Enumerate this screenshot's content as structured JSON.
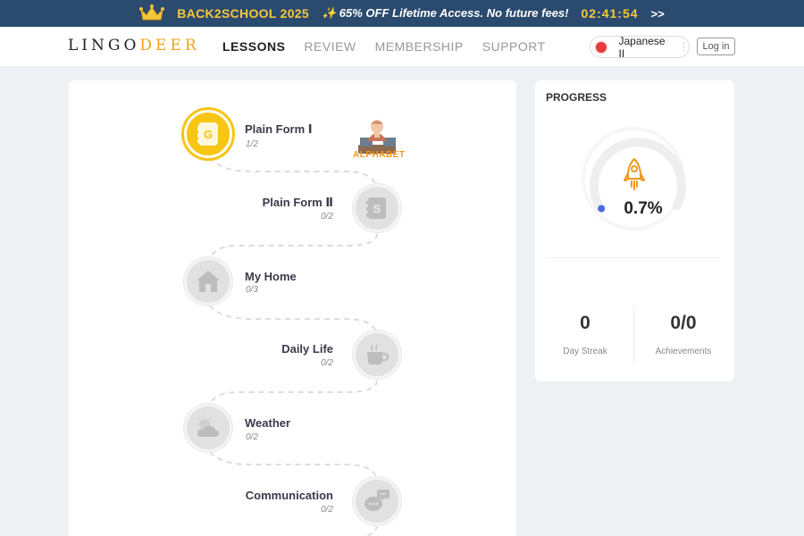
{
  "promo": {
    "code": "BACK2SCHOOL 2025",
    "offer": "✨ 65% OFF Lifetime Access. No future fees!",
    "timer": "02:41:54",
    "more": ">>"
  },
  "header": {
    "logo_left": "LINGO",
    "logo_right": "DEER",
    "nav": [
      "LESSONS",
      "REVIEW",
      "MEMBERSHIP",
      "SUPPORT"
    ],
    "active_nav": "LESSONS",
    "language": "Japanese II",
    "login": "Log in"
  },
  "alphabet": {
    "label": "ALPHABET",
    "icon": "alphabet-character-icon"
  },
  "lessons": [
    {
      "title": "Plain Form Ⅰ",
      "progress": "1/2",
      "icon": "letter-g-icon",
      "glyph": "G",
      "active": true
    },
    {
      "title": "Plain Form Ⅱ",
      "progress": "0/2",
      "icon": "letter-s-icon",
      "glyph": "S",
      "active": false
    },
    {
      "title": "My Home",
      "progress": "0/3",
      "icon": "house-icon",
      "active": false
    },
    {
      "title": "Daily Life",
      "progress": "0/2",
      "icon": "coffee-cup-icon",
      "active": false
    },
    {
      "title": "Weather",
      "progress": "0/2",
      "icon": "sun-cloud-icon",
      "active": false
    },
    {
      "title": "Communication",
      "progress": "0/2",
      "icon": "chat-bubbles-icon",
      "active": false
    }
  ],
  "progress": {
    "heading": "PROGRESS",
    "percent": "0.7%",
    "fraction": 0.007,
    "icon": "rocket-icon",
    "stats": [
      {
        "value": "0",
        "label": "Day Streak"
      },
      {
        "value": "0/0",
        "label": "Achievements"
      }
    ]
  },
  "colors": {
    "banner": "#2a4a6e",
    "banner_accent": "#f6c83b",
    "brand_accent": "#f4a11a",
    "active_lesson": "#f7c513",
    "inactive_lesson": "#e1e1e1",
    "rocket": "#f39619",
    "ring_dot": "#4a68e0"
  }
}
